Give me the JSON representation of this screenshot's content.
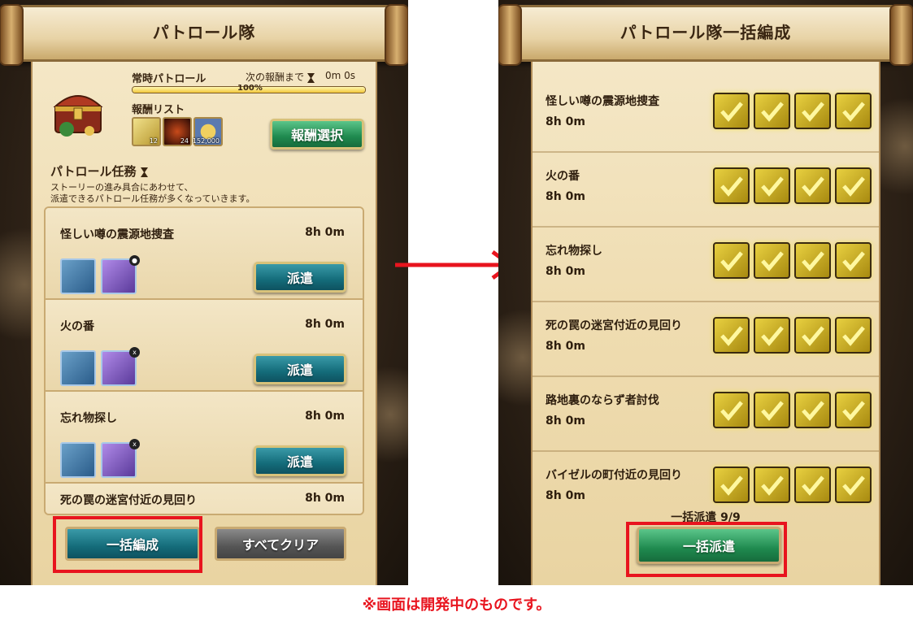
{
  "left": {
    "title": "パトロール隊",
    "reward": {
      "header": "常時パトロール",
      "timer_label": "次の報酬まで",
      "timer_value": "0m 0s",
      "progress_text": "100%",
      "progress": 1.0,
      "list_label": "報酬リスト",
      "items": [
        {
          "icon": "crystal-icon",
          "count": "12"
        },
        {
          "icon": "dark-gem-icon",
          "count": "24"
        },
        {
          "icon": "gold-coin-icon",
          "count": "152,000"
        }
      ],
      "select_label": "報酬選択"
    },
    "section_title": "パトロール任務",
    "section_desc_line1": "ストーリーの進み具合にあわせて、",
    "section_desc_line2": "派遣できるパトロール任務が多くなっていきます。",
    "missions": [
      {
        "name": "怪しい噂の震源地捜査",
        "time": "8h 0m",
        "dispatch": "派遣"
      },
      {
        "name": "火の番",
        "time": "8h 0m",
        "dispatch": "派遣"
      },
      {
        "name": "忘れ物探し",
        "time": "8h 0m",
        "dispatch": "派遣"
      },
      {
        "name": "死の罠の迷宮付近の見回り",
        "time": "8h 0m"
      }
    ],
    "bulk_organize": "一括編成",
    "clear_all": "すべてクリア"
  },
  "right": {
    "title": "パトロール隊一括編成",
    "missions": [
      {
        "name": "怪しい噂の震源地捜査",
        "time": "8h 0m"
      },
      {
        "name": "火の番",
        "time": "8h 0m"
      },
      {
        "name": "忘れ物探し",
        "time": "8h 0m"
      },
      {
        "name": "死の罠の迷宮付近の見回り",
        "time": "8h 0m"
      },
      {
        "name": "路地裏のならず者討伐",
        "time": "8h 0m"
      },
      {
        "name": "バイゼルの町付近の見回り",
        "time": "8h 0m"
      }
    ],
    "bulk_count": "一括派遣 9/9",
    "bulk_dispatch": "一括派遣"
  },
  "note": "※画面は開発中のものです。",
  "colors": {
    "highlight": "#e8141e",
    "accent_green": "#1f8a4f",
    "accent_teal": "#146c7a"
  }
}
